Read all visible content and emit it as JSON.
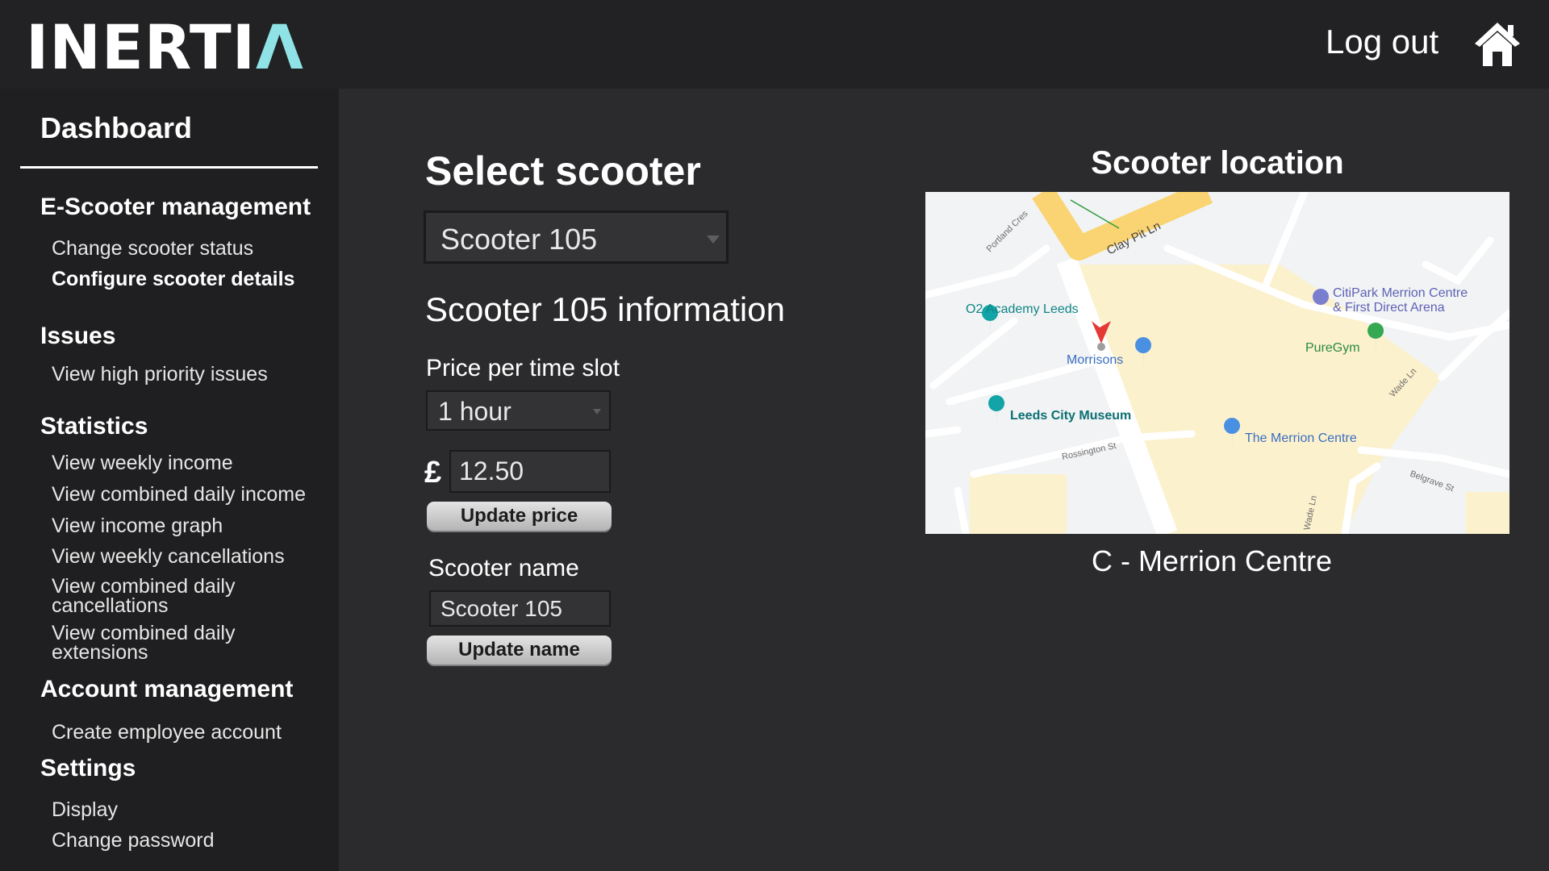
{
  "header": {
    "logo_main": "INERTI",
    "logo_accent": "Λ",
    "logout_label": "Log out",
    "home_icon": "home-icon"
  },
  "sidebar": {
    "title": "Dashboard",
    "sections": [
      {
        "heading": "E-Scooter management",
        "items": [
          "Change scooter status",
          "Configure scooter details"
        ]
      },
      {
        "heading": "Issues",
        "items": [
          "View high priority issues"
        ]
      },
      {
        "heading": "Statistics",
        "items": [
          "View weekly income",
          "View combined daily income",
          "View income graph",
          "View weekly cancellations",
          "View combined daily cancellations",
          "View combined daily extensions"
        ]
      },
      {
        "heading": "Account management",
        "items": [
          "Create employee account"
        ]
      },
      {
        "heading": "Settings",
        "items": [
          "Display",
          "Change password"
        ]
      }
    ],
    "active_item": "Configure scooter details"
  },
  "main": {
    "title": "Select scooter",
    "selected_scooter": "Scooter 105",
    "info_title": "Scooter 105 information",
    "price_label": "Price per time slot",
    "time_slot": "1 hour",
    "currency_symbol": "£",
    "price_value": "12.50",
    "update_price_label": "Update price",
    "name_label": "Scooter name",
    "name_value": "Scooter 105",
    "update_name_label": "Update name"
  },
  "map": {
    "title": "Scooter location",
    "location_caption": "C - Merrion Centre",
    "places": {
      "o2": "O2 Academy Leeds",
      "morrisons": "Morrisons",
      "museum": "Leeds City Museum",
      "citipark_1": "CitiPark Merrion Centre",
      "citipark_2": "& First Direct Arena",
      "puregym": "PureGym",
      "merrion": "The Merrion Centre"
    },
    "streets": {
      "clay_pit": "Clay Pit Ln",
      "portland": "Portland Cres",
      "rossington": "Rossington St",
      "belgrave": "Belgrave St",
      "wade": "Wade Ln",
      "wade2": "Wade Ln"
    },
    "colors": {
      "land": "#f1f3f4",
      "block": "#fcf1cd",
      "main_road": "#fad472",
      "road": "#ffffff",
      "pin": "#e53935"
    }
  }
}
